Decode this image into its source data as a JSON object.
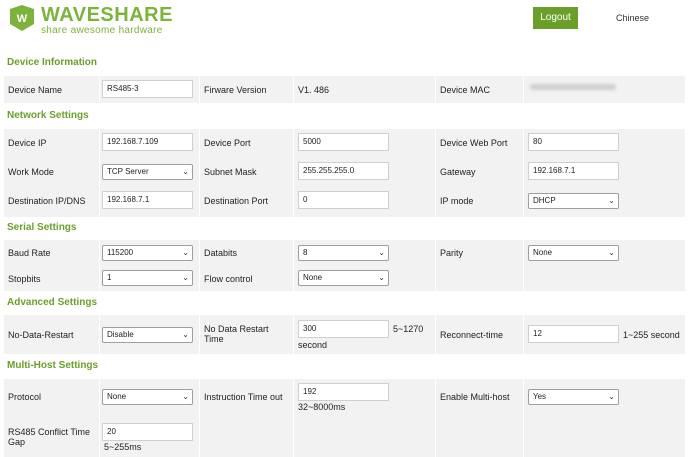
{
  "header": {
    "logo_name": "WAVESHARE",
    "logo_tagline": "share awesome hardware",
    "logout_label": "Logout",
    "language_label": "Chinese",
    "brand_color": "#6aa02a"
  },
  "sections": {
    "device": "Device Information",
    "network": "Network Settings",
    "serial": "Serial Settings",
    "advanced": "Advanced Settings",
    "multihost": "Multi-Host Settings"
  },
  "device": {
    "name_label": "Device Name",
    "name_value": "RS485-3",
    "firmware_label": "Firware Version",
    "firmware_value": "V1. 486",
    "mac_label": "Device MAC"
  },
  "network": {
    "ip_label": "Device IP",
    "ip_value": "192.168.7.109",
    "port_label": "Device Port",
    "port_value": "5000",
    "web_port_label": "Device Web Port",
    "web_port_value": "80",
    "work_mode_label": "Work Mode",
    "work_mode_value": "TCP Server",
    "subnet_label": "Subnet Mask",
    "subnet_value": "255.255.255.0",
    "gateway_label": "Gateway",
    "gateway_value": "192.168.7.1",
    "dest_ip_label": "Destination IP/DNS",
    "dest_ip_value": "192.168.7.1",
    "dest_port_label": "Destination Port",
    "dest_port_value": "0",
    "ip_mode_label": "IP mode",
    "ip_mode_value": "DHCP"
  },
  "serial": {
    "baud_label": "Baud Rate",
    "baud_value": "115200",
    "databits_label": "Databits",
    "databits_value": "8",
    "parity_label": "Parity",
    "parity_value": "None",
    "stopbits_label": "Stopbits",
    "stopbits_value": "1",
    "flow_label": "Flow control",
    "flow_value": "None"
  },
  "advanced": {
    "no_data_restart_label": "No-Data-Restart",
    "no_data_restart_value": "Disable",
    "no_data_time_label_1": "No Data Restart",
    "no_data_time_label_2": "Time",
    "no_data_time_value": "300",
    "no_data_time_range": "5~1270",
    "no_data_time_unit": "second",
    "reconnect_label": "Reconnect-time",
    "reconnect_value": "12",
    "reconnect_range": "1~255 second"
  },
  "multihost": {
    "protocol_label": "Protocol",
    "protocol_value": "None",
    "timeout_label": "Instruction Time out",
    "timeout_value": "192",
    "timeout_range": "32~8000ms",
    "enable_label": "Enable Multi-host",
    "enable_value": "Yes",
    "conflict_label_1": "RS485 Conflict Time",
    "conflict_label_2": "Gap",
    "conflict_value": "20",
    "conflict_range": "5~255ms"
  },
  "icons": {
    "dropdown": "chevron-down-icon",
    "logo": "waveshare-logo-icon"
  }
}
